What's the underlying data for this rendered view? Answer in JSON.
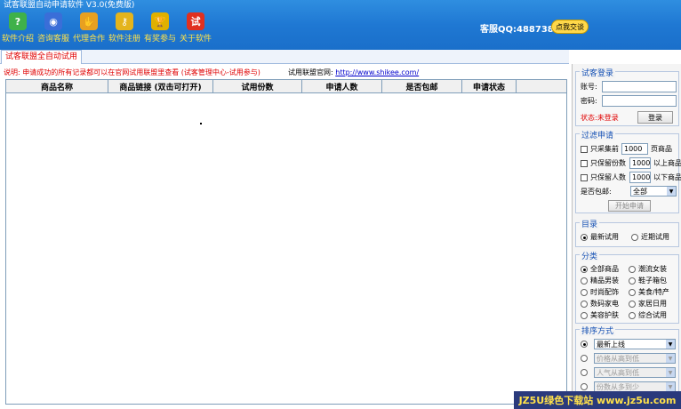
{
  "window": {
    "title": "试客联盟自动申请软件 V3.0(免费版)"
  },
  "toolbar": [
    {
      "label": "软件介绍",
      "icon": "help-icon",
      "color": "#3fb14a",
      "glyph": "?"
    },
    {
      "label": "咨询客服",
      "icon": "chat-icon",
      "color": "#3a6ed8",
      "glyph": "◉"
    },
    {
      "label": "代理合作",
      "icon": "handshake-icon",
      "color": "#e8a020",
      "glyph": "✋"
    },
    {
      "label": "软件注册",
      "icon": "key-icon",
      "color": "#e4b41c",
      "glyph": "⚷"
    },
    {
      "label": "有奖参与",
      "icon": "trophy-icon",
      "color": "#e0b000",
      "glyph": "🏆"
    },
    {
      "label": "关于软件",
      "icon": "about-icon",
      "color": "#e03020",
      "glyph": "试"
    }
  ],
  "header": {
    "contact": "客服QQ:488738580",
    "qq_button": "点我交谈"
  },
  "tabs": [
    {
      "label": "试客联盟全自动试用"
    }
  ],
  "notice": {
    "text": "说明: 申请成功的所有记录都可以在官网试用联盟里查看 (试客管理中心-试用参与)",
    "site_label": "试用联盟官网:",
    "site_url": "http://www.shikee.com/"
  },
  "table": {
    "columns": [
      "商品名称",
      "商品链接 (双击可打开)",
      "试用份数",
      "申请人数",
      "是否包邮",
      "申请状态"
    ]
  },
  "login": {
    "title": "试客登录",
    "account_label": "账号:",
    "password_label": "密码:",
    "status": "状态:未登录",
    "login_button": "登录"
  },
  "filter": {
    "title": "过滤申请",
    "opt1_label": "只采集前",
    "opt1_value": "1000",
    "opt1_suffix": "页商品",
    "opt2_label": "只保留份数",
    "opt2_value": "1000",
    "opt2_suffix": "以上商品",
    "opt3_label": "只保留人数",
    "opt3_value": "1000",
    "opt3_suffix": "以下商品",
    "free_ship_label": "是否包邮:",
    "free_ship_value": "全部",
    "start_button": "开始申请"
  },
  "catalog": {
    "title": "目录",
    "options": [
      "最新试用",
      "近期试用"
    ]
  },
  "category": {
    "title": "分类",
    "options": [
      "全部商品",
      "潮流女装",
      "精品男装",
      "鞋子箱包",
      "时尚配饰",
      "美食/特产",
      "数码家电",
      "家居日用",
      "美容护肤",
      "综合试用"
    ]
  },
  "sort": {
    "title": "排序方式",
    "options": [
      "最新上线",
      "价格从高到低",
      "人气从高到低",
      "份数从多到少"
    ]
  },
  "watermark": {
    "text": "JZ5U绿色下载站 www.jz5u.com"
  }
}
